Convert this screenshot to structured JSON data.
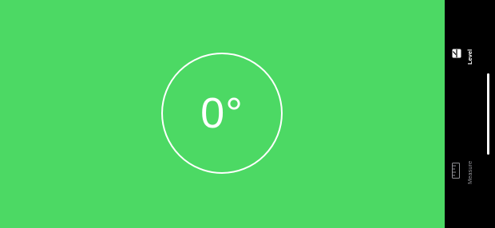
{
  "level": {
    "angle": "0°",
    "background_color": "#4cd964",
    "ring_color": "#ffffff"
  },
  "mode_bar": {
    "tabs": [
      {
        "label": "Level",
        "icon": "level-icon",
        "selected": true
      },
      {
        "label": "Measure",
        "icon": "ruler-icon",
        "selected": false
      }
    ]
  }
}
